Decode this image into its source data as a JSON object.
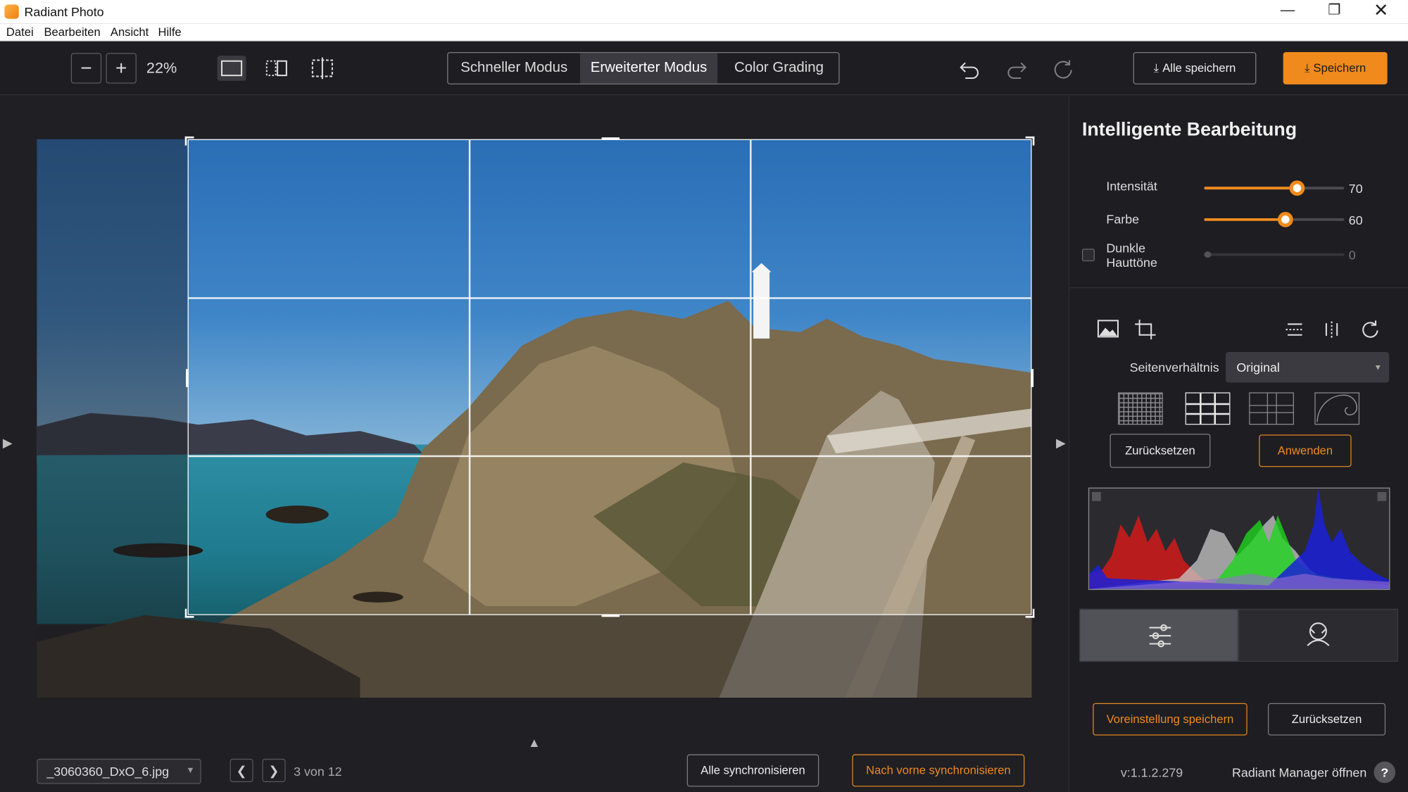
{
  "app": {
    "title": "Radiant Photo"
  },
  "menu": [
    "Datei",
    "Bearbeiten",
    "Ansicht",
    "Hilfe"
  ],
  "toolbar": {
    "zoom_out": "−",
    "zoom_in": "+",
    "zoom_level": "22%",
    "modes": [
      {
        "label": "Schneller Modus",
        "active": false
      },
      {
        "label": "Erweiterter Modus",
        "active": true
      },
      {
        "label": "Color Grading",
        "active": false
      }
    ],
    "save_all_label": "Alle speichern",
    "save_label": "Speichern"
  },
  "footer": {
    "filename": "_3060360_DxO_6.jpg",
    "counter": "3 von 12",
    "sync_all_label": "Alle synchronisieren",
    "sync_forward_label": "Nach vorne synchronisieren"
  },
  "panel": {
    "title": "Intelligente Bearbeitung",
    "sliders": [
      {
        "label": "Intensität",
        "value": "70",
        "fraction": 0.7
      },
      {
        "label": "Farbe",
        "value": "60",
        "fraction": 0.6
      },
      {
        "label": "Dunkle Hauttöne",
        "value": "0",
        "fraction": 0.0,
        "disabled": true
      }
    ],
    "aspect_label": "Seitenverhältnis",
    "aspect_value": "Original",
    "reset_label": "Zurücksetzen",
    "apply_label": "Anwenden",
    "save_preset_label": "Voreinstellung speichern",
    "reset2_label": "Zurücksetzen",
    "version": "v:1.1.2.279",
    "manager_label": "Radiant Manager öffnen",
    "help_label": "?"
  },
  "colors": {
    "accent": "#f08a1c",
    "background": "#1e1e22"
  }
}
